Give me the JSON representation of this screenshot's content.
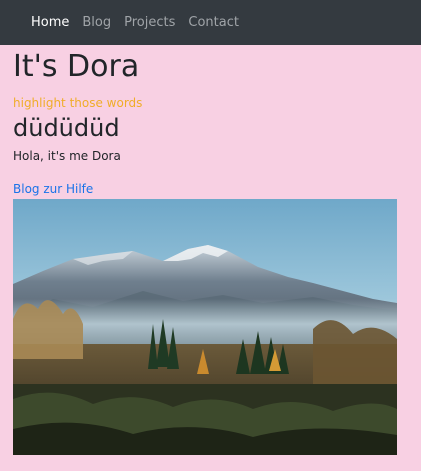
{
  "nav": {
    "items": [
      {
        "label": "Home"
      },
      {
        "label": "Blog"
      },
      {
        "label": "Projects"
      },
      {
        "label": "Contact"
      }
    ]
  },
  "main": {
    "title": "It's Dora",
    "highlight": "highlight those words",
    "subtitle": "düdüdüd",
    "paragraph": "Hola, it's me Dora",
    "link": "Blog zur Hilfe"
  },
  "colors": {
    "navbar": "#343a40",
    "page_background": "#f8d0e3",
    "highlight": "#f0ad29",
    "link": "#1a73e8"
  }
}
